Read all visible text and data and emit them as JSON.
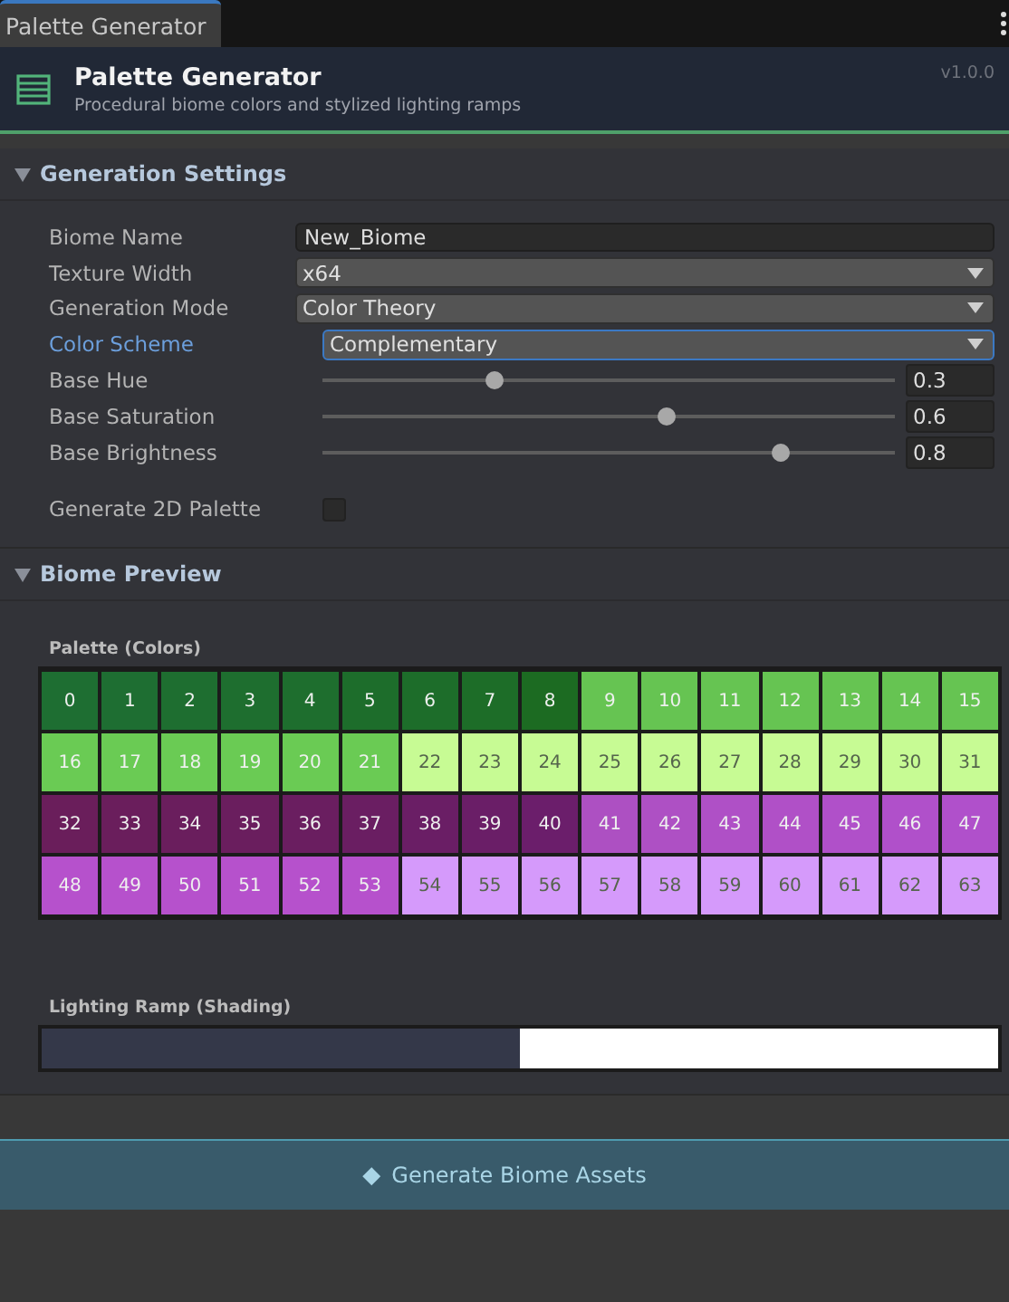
{
  "tab": {
    "label": "Palette Generator",
    "selected": true
  },
  "header": {
    "title": "Palette Generator",
    "subtitle": "Procedural biome colors and stylized lighting ramps",
    "version": "v1.0.0"
  },
  "settings": {
    "title": "Generation Settings",
    "expanded": true,
    "fields": [
      {
        "kind": "text",
        "label": "Biome Name",
        "value": "New_Biome",
        "focused": false
      },
      {
        "kind": "dropdown",
        "label": "Texture Width",
        "value": "x64",
        "focused": false
      },
      {
        "kind": "dropdown",
        "label": "Generation Mode",
        "value": "Color Theory",
        "focused": false
      },
      {
        "kind": "dropdown",
        "label": "Color Scheme",
        "value": "Complementary",
        "focused": true
      },
      {
        "kind": "slider",
        "label": "Base Hue",
        "value": "0.3",
        "level": 0.3,
        "focused": false
      },
      {
        "kind": "slider",
        "label": "Base Saturation",
        "value": "0.6",
        "level": 0.6,
        "focused": false
      },
      {
        "kind": "slider",
        "label": "Base Brightness",
        "value": "0.8",
        "level": 0.8,
        "focused": false
      },
      {
        "kind": "checkbox",
        "label": "Generate 2D Palette",
        "checked": false,
        "focused": false
      }
    ]
  },
  "preview": {
    "title": "Biome Preview",
    "expanded": true,
    "palette_label": "Palette (Colors)",
    "swatches": [
      {
        "label": "0",
        "color": "#1e6e32"
      },
      {
        "label": "1",
        "color": "#1e6e32"
      },
      {
        "label": "2",
        "color": "#1e6e30"
      },
      {
        "label": "3",
        "color": "#1e6e2f"
      },
      {
        "label": "4",
        "color": "#1e6e2e"
      },
      {
        "label": "5",
        "color": "#1d6d2b"
      },
      {
        "label": "6",
        "color": "#1d6d2a"
      },
      {
        "label": "7",
        "color": "#1d6d28"
      },
      {
        "label": "8",
        "color": "#1c6b22"
      },
      {
        "label": "9",
        "color": "#66c452"
      },
      {
        "label": "10",
        "color": "#66c452"
      },
      {
        "label": "11",
        "color": "#66c452"
      },
      {
        "label": "12",
        "color": "#66c452"
      },
      {
        "label": "13",
        "color": "#66c452"
      },
      {
        "label": "14",
        "color": "#66c452"
      },
      {
        "label": "15",
        "color": "#66c452"
      },
      {
        "label": "16",
        "color": "#6acb54"
      },
      {
        "label": "17",
        "color": "#6acb54"
      },
      {
        "label": "18",
        "color": "#6acb54"
      },
      {
        "label": "19",
        "color": "#6acb54"
      },
      {
        "label": "20",
        "color": "#6acb54"
      },
      {
        "label": "21",
        "color": "#6acb54"
      },
      {
        "label": "22",
        "color": "#c7fb94"
      },
      {
        "label": "23",
        "color": "#c7fb94"
      },
      {
        "label": "24",
        "color": "#c7fb94"
      },
      {
        "label": "25",
        "color": "#c7fb94"
      },
      {
        "label": "26",
        "color": "#c7fb94"
      },
      {
        "label": "27",
        "color": "#c7fb94"
      },
      {
        "label": "28",
        "color": "#c7fb94"
      },
      {
        "label": "29",
        "color": "#c7fb94"
      },
      {
        "label": "30",
        "color": "#c7fb94"
      },
      {
        "label": "31",
        "color": "#c7fb94"
      },
      {
        "label": "32",
        "color": "#6a1e5b"
      },
      {
        "label": "33",
        "color": "#6a1e5c"
      },
      {
        "label": "34",
        "color": "#6a1e5d"
      },
      {
        "label": "35",
        "color": "#6a1e5e"
      },
      {
        "label": "36",
        "color": "#6a1e60"
      },
      {
        "label": "37",
        "color": "#6a1e62"
      },
      {
        "label": "38",
        "color": "#6a1e65"
      },
      {
        "label": "39",
        "color": "#6a1e67"
      },
      {
        "label": "40",
        "color": "#6b1e6b"
      },
      {
        "label": "41",
        "color": "#ad50c2"
      },
      {
        "label": "42",
        "color": "#ae50c4"
      },
      {
        "label": "43",
        "color": "#af50c6"
      },
      {
        "label": "44",
        "color": "#b050c7"
      },
      {
        "label": "45",
        "color": "#b050c9"
      },
      {
        "label": "46",
        "color": "#b050ca"
      },
      {
        "label": "47",
        "color": "#b050cb"
      },
      {
        "label": "48",
        "color": "#b651cc"
      },
      {
        "label": "49",
        "color": "#b651cc"
      },
      {
        "label": "50",
        "color": "#b651cc"
      },
      {
        "label": "51",
        "color": "#b651cc"
      },
      {
        "label": "52",
        "color": "#b651cc"
      },
      {
        "label": "53",
        "color": "#b651cc"
      },
      {
        "label": "54",
        "color": "#d59afb"
      },
      {
        "label": "55",
        "color": "#d59afb"
      },
      {
        "label": "56",
        "color": "#d59afb"
      },
      {
        "label": "57",
        "color": "#d59afb"
      },
      {
        "label": "58",
        "color": "#d59afb"
      },
      {
        "label": "59",
        "color": "#d59afb"
      },
      {
        "label": "60",
        "color": "#d59afb"
      },
      {
        "label": "61",
        "color": "#d59afb"
      },
      {
        "label": "62",
        "color": "#d59afb"
      },
      {
        "label": "63",
        "color": "#d59afb"
      }
    ],
    "ramp_label": "Lighting Ramp (Shading)",
    "ramp": [
      {
        "color": "#343849"
      },
      {
        "color": "#ffffff"
      }
    ]
  },
  "action": {
    "label": "Generate Biome Assets",
    "icon": "◆"
  }
}
